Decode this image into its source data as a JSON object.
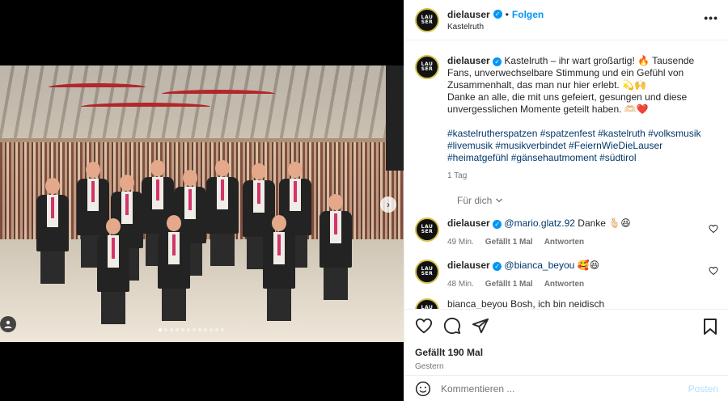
{
  "post": {
    "username": "dielauser",
    "follow_label": "Folgen",
    "location": "Kastelruth",
    "avatar_logo": "LAU SER"
  },
  "caption": {
    "username": "dielauser",
    "text_line1": "Kastelruth – ihr wart großartig! 🔥 Tausende Fans, unverwechselbare Stimmung und ein Gefühl von Zusammenhalt, das man nur hier erlebt. 💫🙌",
    "text_line2": "Danke an alle, die mit uns gefeiert, gesungen und diese unvergesslichen Momente geteilt haben. 🫶🏻❤️",
    "hashtags": "#kastelrutherspatzen #spatzenfest #kastelruth #volksmusik #livemusik #musikverbindet #FeiernWieDieLauser #heimatgefühl #gänsehautmoment #südtirol",
    "time": "1 Tag"
  },
  "for_you_label": "Für dich",
  "comments": [
    {
      "username": "dielauser",
      "mention": "@mario.glatz.92",
      "text": "Danke 🫰🏻😆",
      "time": "49 Min.",
      "likes": "Gefällt 1 Mal",
      "reply": "Antworten"
    },
    {
      "username": "dielauser",
      "mention": "@bianca_beyou",
      "text": "🥰😆",
      "time": "48 Min.",
      "likes": "Gefällt 1 Mal",
      "reply": "Antworten"
    }
  ],
  "partial_comment": "bianca_beyou Bosh, ich bin neidisch",
  "likes_text": "Gefällt 190 Mal",
  "date_text": "Gestern",
  "add_comment": {
    "placeholder": "Kommentieren ...",
    "post_label": "Posten"
  },
  "carousel": {
    "total_slides": 12,
    "active_index": 0
  },
  "colors": {
    "link": "#00376b",
    "follow": "#0095f6",
    "verified": "#0095f6",
    "avatar_ring": "#d4c24a"
  },
  "icons": [
    "heart-icon",
    "comment-icon",
    "share-icon",
    "bookmark-icon",
    "more-icon",
    "emoji-icon",
    "chevron-right-icon",
    "user-tag-icon"
  ]
}
